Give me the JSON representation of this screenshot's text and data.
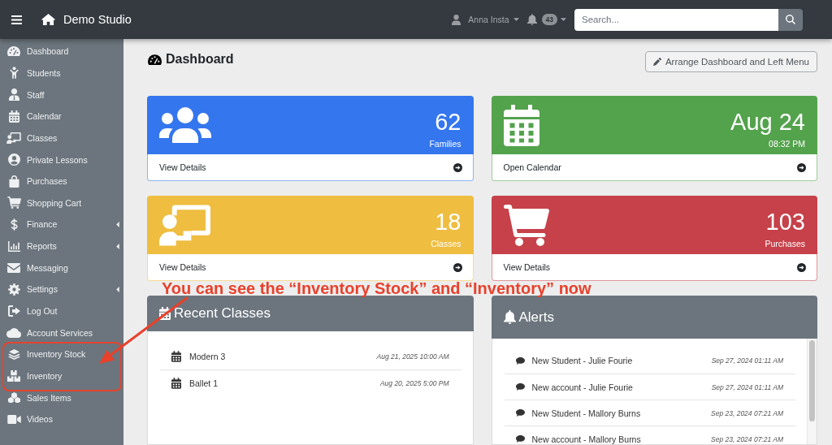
{
  "topbar": {
    "brand": "Demo Studio",
    "user": {
      "name": "Anna Insta"
    },
    "notifications": {
      "count": "43"
    },
    "search": {
      "placeholder": "Search..."
    }
  },
  "sidebar": {
    "items": [
      {
        "label": "Dashboard",
        "has_submenu": false,
        "highlighted": false
      },
      {
        "label": "Students",
        "has_submenu": false,
        "highlighted": false
      },
      {
        "label": "Staff",
        "has_submenu": false,
        "highlighted": false
      },
      {
        "label": "Calendar",
        "has_submenu": false,
        "highlighted": false
      },
      {
        "label": "Classes",
        "has_submenu": false,
        "highlighted": false
      },
      {
        "label": "Private Lessons",
        "has_submenu": false,
        "highlighted": false
      },
      {
        "label": "Purchases",
        "has_submenu": false,
        "highlighted": false
      },
      {
        "label": "Shopping Cart",
        "has_submenu": false,
        "highlighted": false
      },
      {
        "label": "Finance",
        "has_submenu": true,
        "highlighted": false
      },
      {
        "label": "Reports",
        "has_submenu": true,
        "highlighted": false
      },
      {
        "label": "Messaging",
        "has_submenu": false,
        "highlighted": false
      },
      {
        "label": "Settings",
        "has_submenu": true,
        "highlighted": false
      },
      {
        "label": "Log Out",
        "has_submenu": false,
        "highlighted": false
      },
      {
        "label": "Account Services",
        "has_submenu": false,
        "highlighted": false
      },
      {
        "label": "Inventory Stock",
        "has_submenu": false,
        "highlighted": true
      },
      {
        "label": "Inventory",
        "has_submenu": false,
        "highlighted": true
      },
      {
        "label": "Sales Items",
        "has_submenu": false,
        "highlighted": false
      },
      {
        "label": "Videos",
        "has_submenu": false,
        "highlighted": false
      }
    ]
  },
  "header": {
    "title": "Dashboard",
    "button": "Arrange Dashboard and Left Menu"
  },
  "stat_cards": [
    {
      "value": "62",
      "label": "Families",
      "link": "View Details",
      "color": "#3476ee"
    },
    {
      "value": "Aug 24",
      "label": "08:32 PM",
      "link": "Open Calendar",
      "color": "#53a24c"
    },
    {
      "value": "18",
      "label": "Classes",
      "link": "View Details",
      "color": "#efbd40"
    },
    {
      "value": "103",
      "label": "Purchases",
      "link": "View Details",
      "color": "#c6414a"
    }
  ],
  "recent_classes": {
    "title": "Recent Classes",
    "rows": [
      {
        "name": "Modern 3",
        "time": "Aug 21, 2025 10:00 AM"
      },
      {
        "name": "Ballet 1",
        "time": "Aug 20, 2025 5:00 PM"
      }
    ]
  },
  "alerts": {
    "title": "Alerts",
    "rows": [
      {
        "text": "New Student - Julie Fourie",
        "time": "Sep 27, 2024 01:11 AM"
      },
      {
        "text": "New account - Julie Fourie",
        "time": "Sep 27, 2024 01:11 AM"
      },
      {
        "text": "New Student - Mallory Burns",
        "time": "Sep 23, 2024 07:21 AM"
      },
      {
        "text": "New account - Mallory Burns",
        "time": "Sep 23, 2024 07:21 AM"
      }
    ]
  },
  "annotation": {
    "text": "You can see the “Inventory Stock” and “Inventory” now"
  }
}
